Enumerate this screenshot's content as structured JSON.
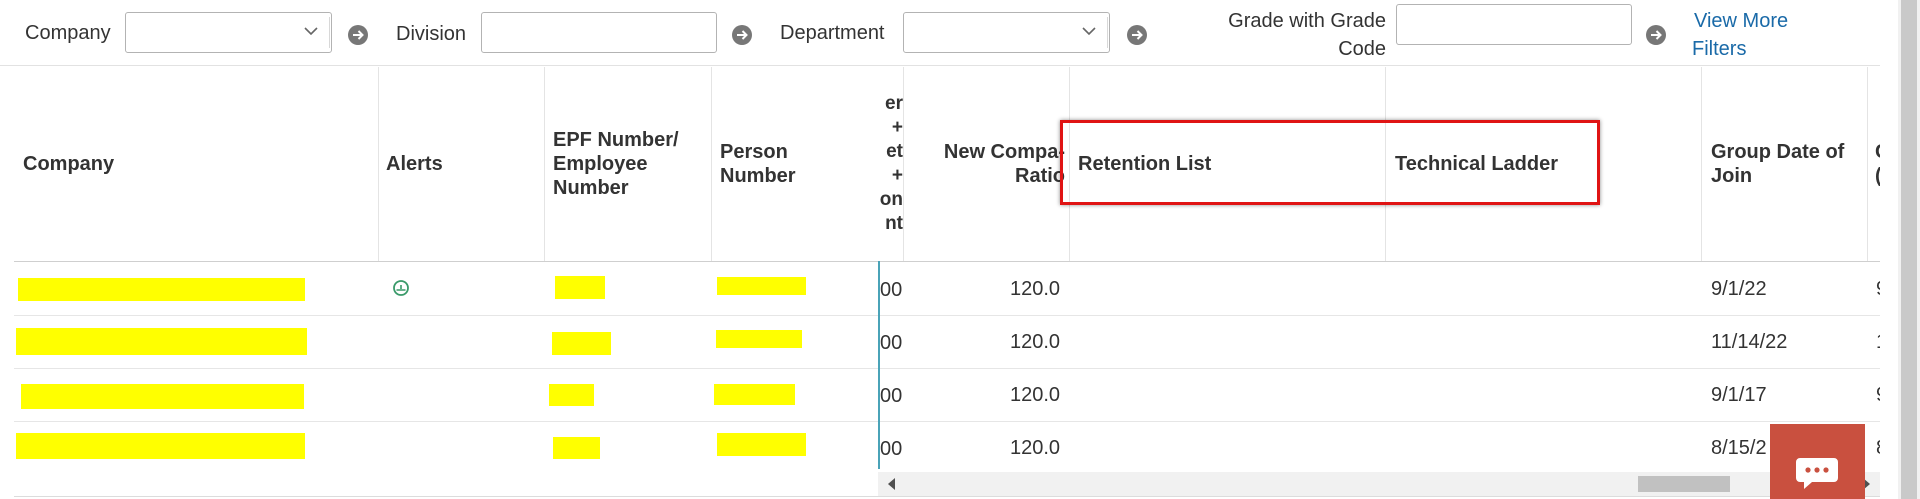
{
  "filters": {
    "company_label": "Company",
    "company_value": "",
    "division_label": "Division",
    "division_value": "",
    "department_label": "Department",
    "department_value": "",
    "grade_label_line1": "Grade with Grade",
    "grade_label_line2": "Code",
    "grade_value": "",
    "view_more_line1": "View More",
    "view_more_line2": "Filters"
  },
  "table": {
    "headers": {
      "company": "Company",
      "alerts": "Alerts",
      "epf_line1": "EPF Number/",
      "epf_line2": "Employee",
      "epf_line3": "Number",
      "person_line1": "Person",
      "person_line2": "Number",
      "clipped_lines": [
        "er",
        "+",
        "et",
        "+",
        "on",
        "nt"
      ],
      "new_compa_line1": "New Compa-",
      "new_compa_line2": "Ratio",
      "retention_list": "Retention List",
      "technical_ladder": "Technical Ladder",
      "group_date_line1": "Group Date of",
      "group_date_line2": "Join",
      "next_clip_line1": "C",
      "next_clip_line2": "("
    },
    "rows": [
      {
        "clipped": "00",
        "new_compa_ratio": "120.0",
        "retention_list": "",
        "technical_ladder": "",
        "group_date_of_join": "9/1/22",
        "next_clip": "9",
        "has_alert": true
      },
      {
        "clipped": "00",
        "new_compa_ratio": "120.0",
        "retention_list": "",
        "technical_ladder": "",
        "group_date_of_join": "11/14/22",
        "next_clip": "1",
        "has_alert": false
      },
      {
        "clipped": "00",
        "new_compa_ratio": "120.0",
        "retention_list": "",
        "technical_ladder": "",
        "group_date_of_join": "9/1/17",
        "next_clip": "9",
        "has_alert": false
      },
      {
        "clipped": "00",
        "new_compa_ratio": "120.0",
        "retention_list": "",
        "technical_ladder": "",
        "group_date_of_join": "8/15/2",
        "next_clip": "8",
        "has_alert": false
      }
    ]
  },
  "colors": {
    "highlight_border": "#e01414",
    "redaction": "#ffff00",
    "link": "#1a6aa8",
    "chat_button": "#c9503f",
    "freeze_line": "#4aa3b8"
  },
  "icons": {
    "go": "arrow-circle-right-icon",
    "alert": "alert-icon",
    "chat": "chat-bubble-icon",
    "chevron": "chevron-down-icon"
  }
}
